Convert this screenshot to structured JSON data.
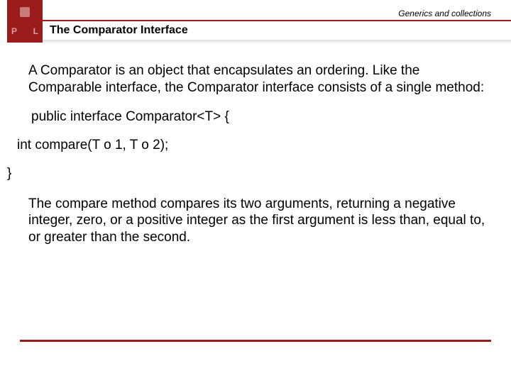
{
  "header": {
    "category": "Generics and collections",
    "title": "The Comparator Interface",
    "logo_letters": {
      "left": "P",
      "right": "L"
    }
  },
  "body": {
    "para1": "A Comparator is an object that encapsulates an ordering. Like the Comparable interface, the Comparator interface consists of a single method:",
    "code_line1": "public interface Comparator<T> {",
    "code_line2": "int compare(T o 1, T o 2);",
    "code_line3": "}",
    "para2": "The compare method compares its two arguments, returning a negative integer, zero, or a positive integer as the first argument is less than, equal to, or greater than the second."
  }
}
